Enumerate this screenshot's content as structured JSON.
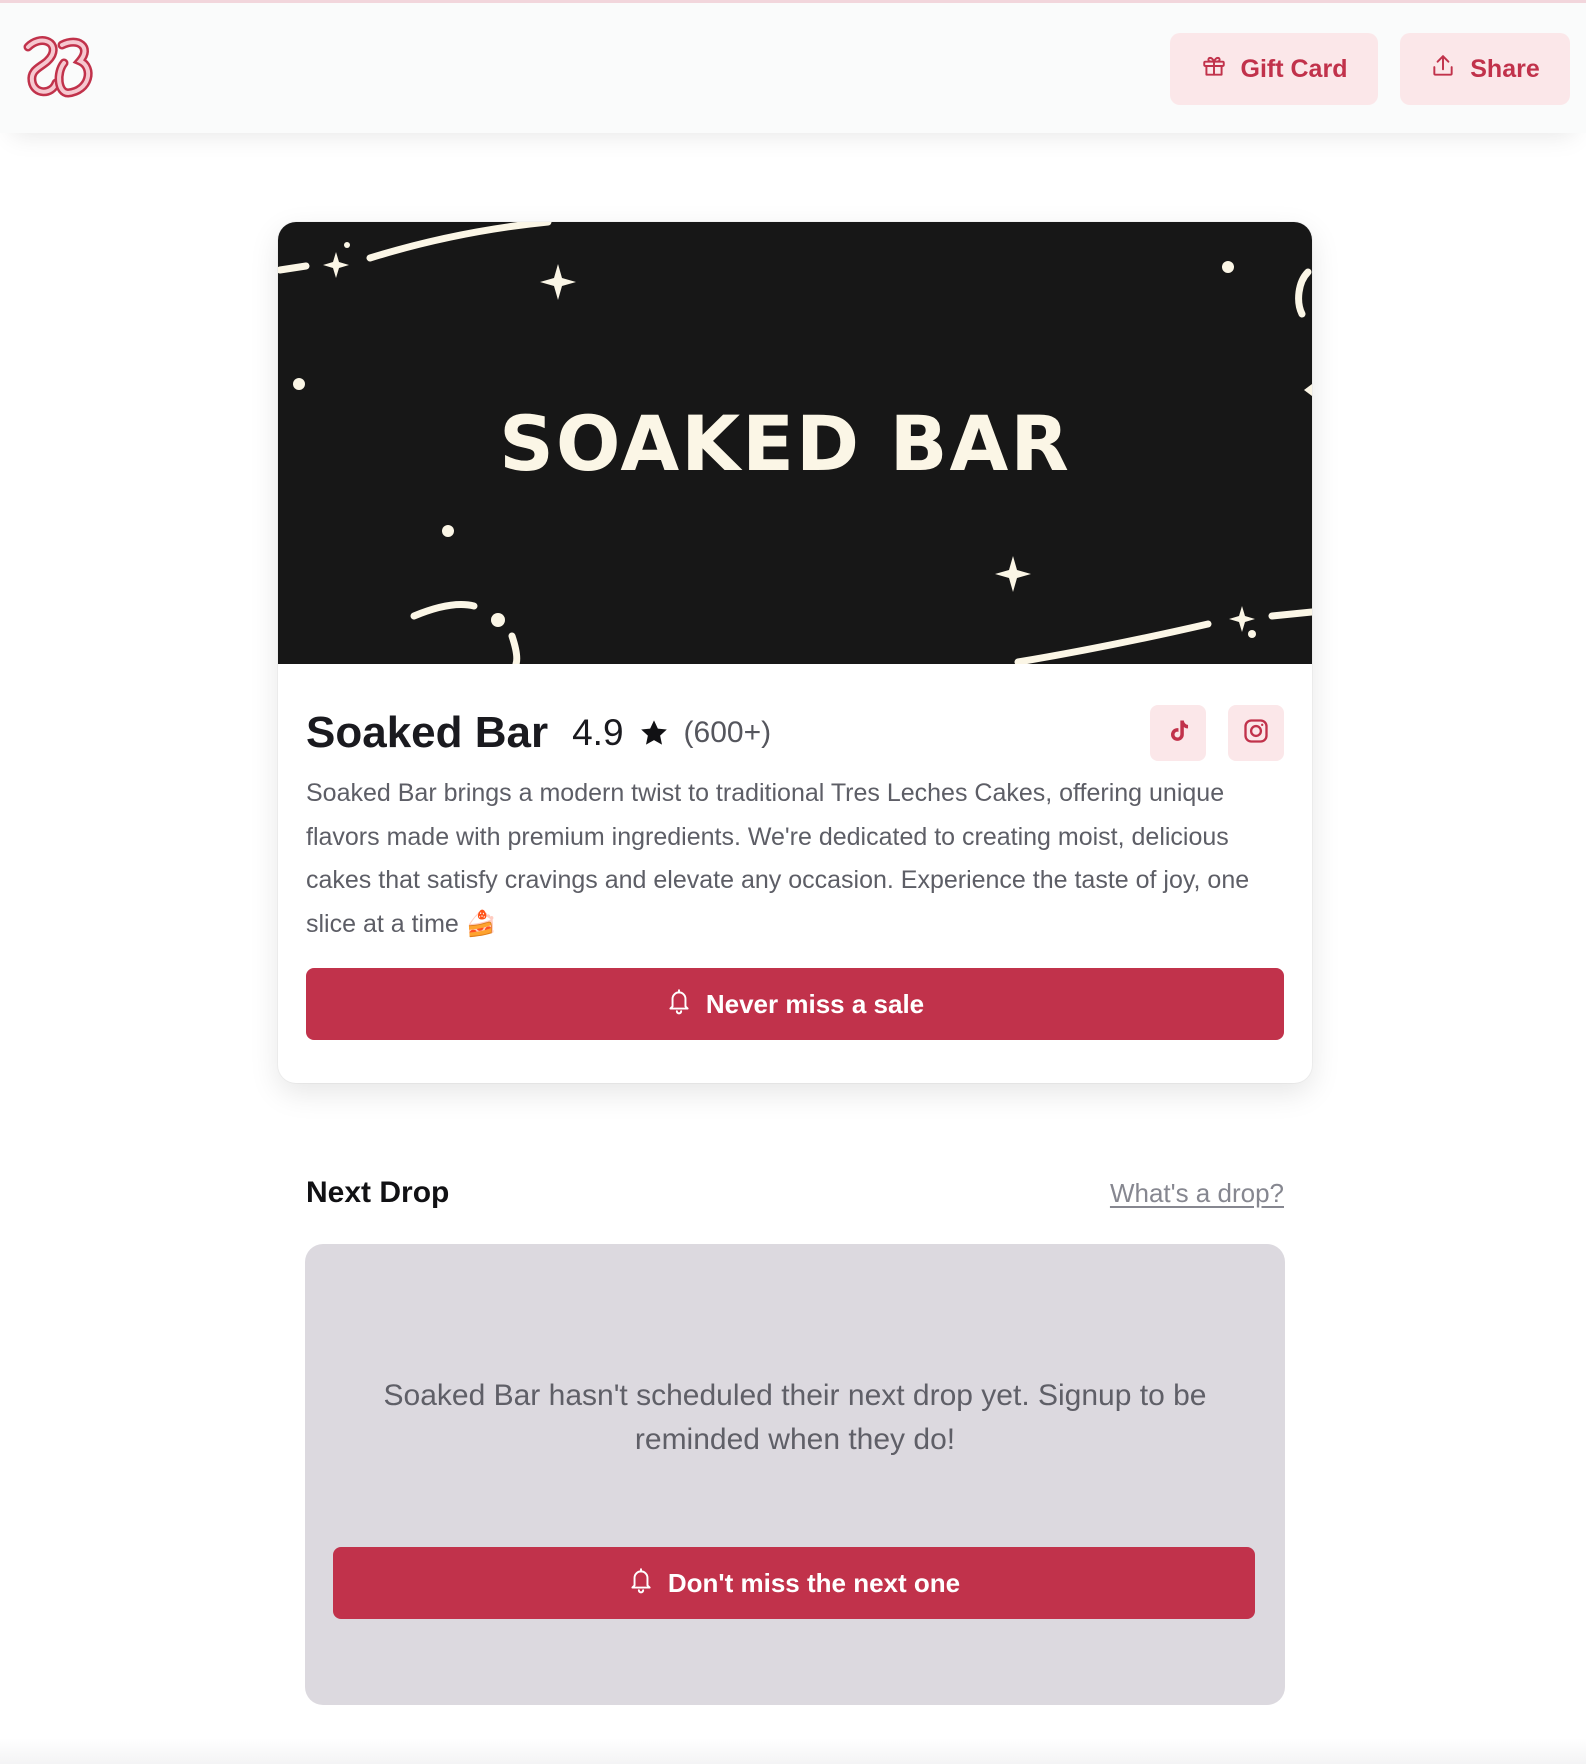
{
  "header": {
    "gift_label": "Gift Card",
    "share_label": "Share"
  },
  "store": {
    "banner_text": "SOAKED BAR",
    "name": "Soaked Bar",
    "rating": "4.9",
    "reviews": "(600+)",
    "description": "Soaked Bar brings a modern twist to traditional Tres Leches Cakes, offering unique flavors made with premium ingredients. We're dedicated to creating moist, delicious cakes that satisfy cravings and elevate any occasion. Experience the taste of joy, one slice at a time 🍰",
    "notify_label": "Never miss a sale"
  },
  "next_drop": {
    "title": "Next Drop",
    "help_link": "What's a drop?",
    "message": "Soaked Bar hasn't scheduled their next drop yet. Signup to be reminded when they do!",
    "cta_label": "Don't miss the next one"
  },
  "colors": {
    "accent": "#c1324b",
    "accent_soft": "#fbe7e9",
    "banner_bg": "#171717",
    "banner_fg": "#fbf6e6",
    "drop_bg": "#dcd9df"
  },
  "icons": [
    "soaked-bar-logo",
    "gift-icon",
    "share-icon",
    "star-icon",
    "tiktok-icon",
    "instagram-icon",
    "bell-icon"
  ]
}
